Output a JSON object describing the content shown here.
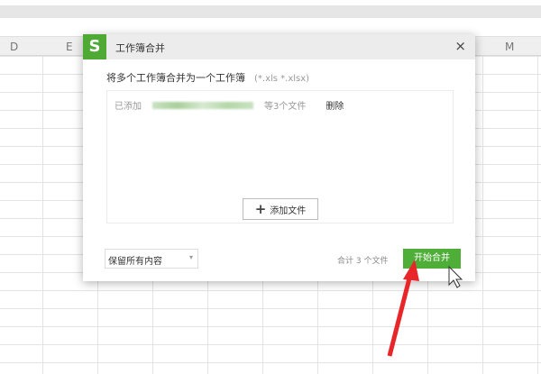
{
  "spreadsheet": {
    "columns": [
      "D",
      "E",
      "M"
    ]
  },
  "dialog": {
    "logo": "S",
    "title": "工作簿合并",
    "close": "×",
    "subtitle": "将多个工作簿合并为一个工作簿",
    "extensions": "(*.xls *.xlsx)",
    "added_label": "已添加",
    "file_count_text": "等3个文件",
    "delete_label": "删除",
    "add_file_label": "添加文件",
    "add_icon": "+",
    "mode_select": "保留所有内容",
    "total_text": "合计 3 个文件",
    "start_button": "开始合并"
  },
  "annotation": {
    "arrow_color": "#e8262a"
  }
}
